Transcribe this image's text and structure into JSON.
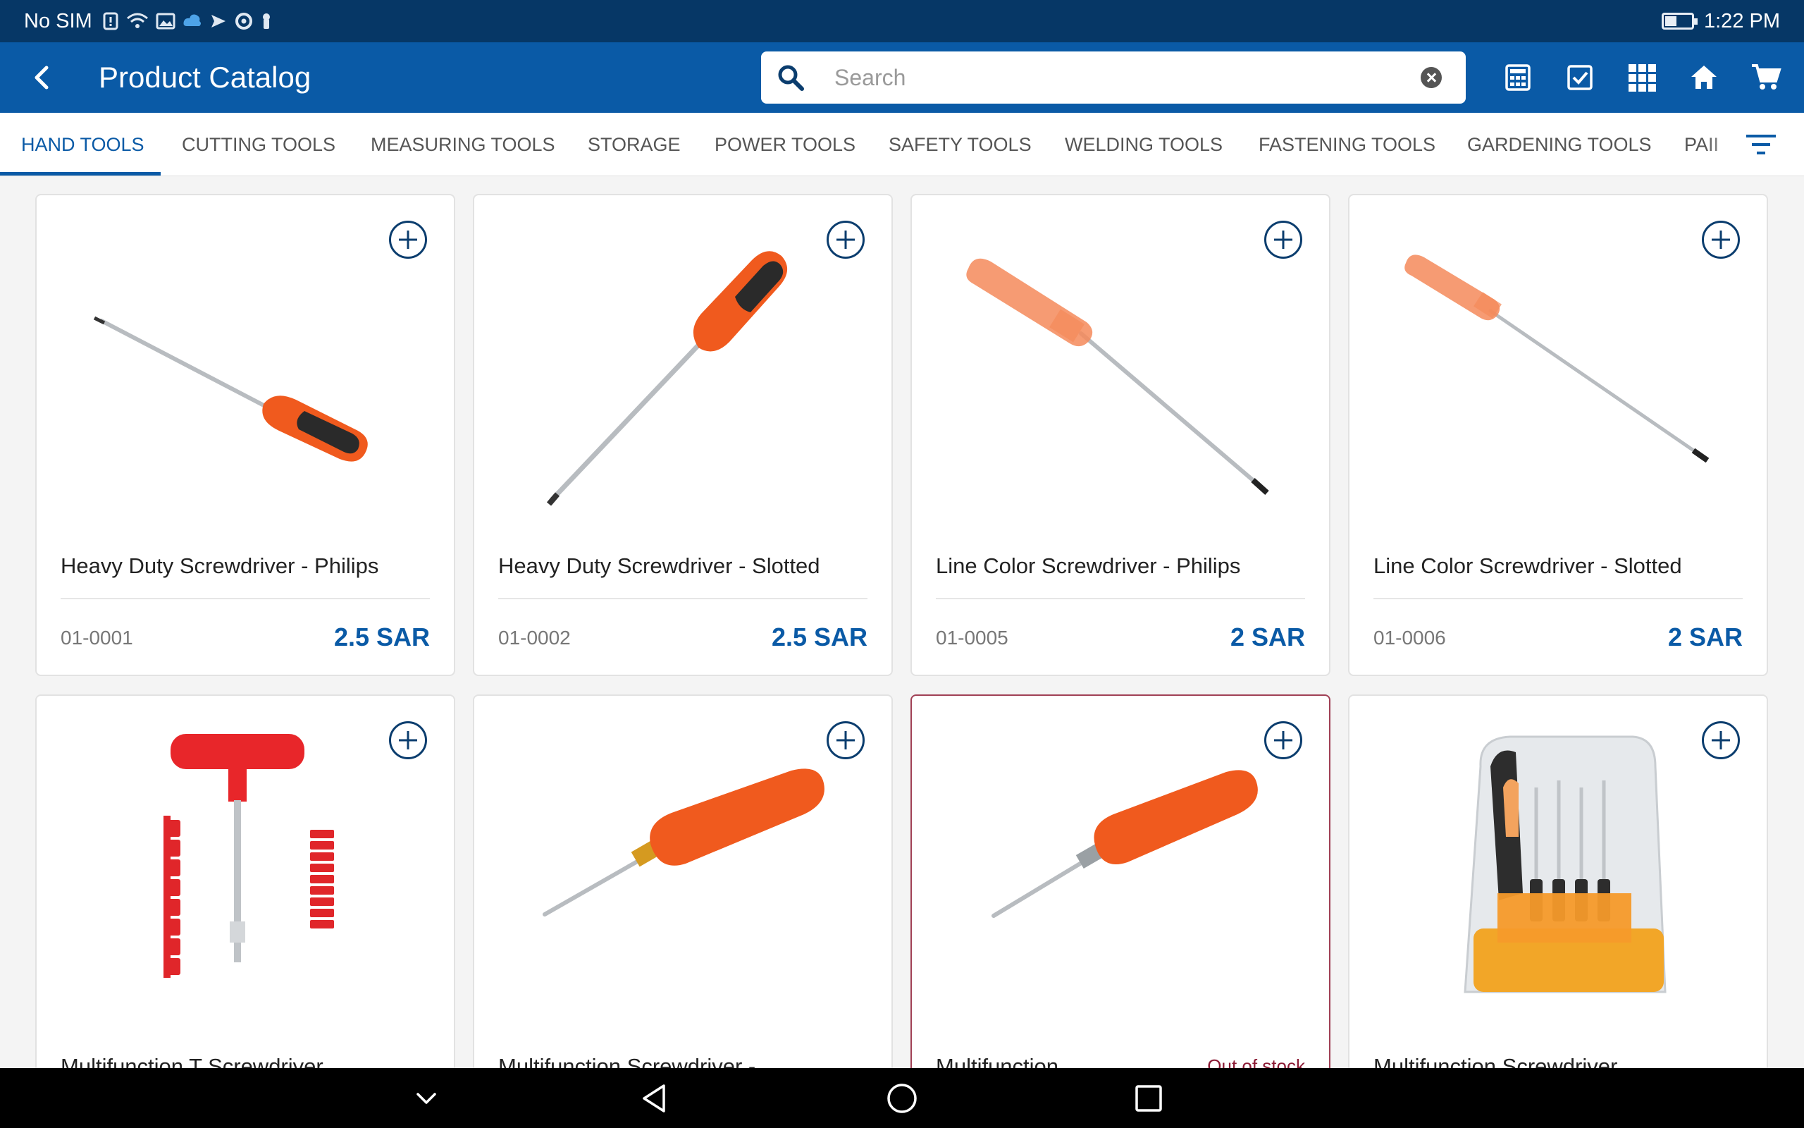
{
  "status_bar": {
    "carrier": "No SIM",
    "time": "1:22 PM"
  },
  "app_bar": {
    "title": "Product Catalog",
    "search_placeholder": "Search"
  },
  "tabs": [
    "HAND TOOLS",
    "CUTTING TOOLS",
    "MEASURING TOOLS",
    "STORAGE",
    "POWER TOOLS",
    "SAFETY TOOLS",
    "WELDING TOOLS",
    "FASTENING TOOLS",
    "GARDENING TOOLS",
    "PAII"
  ],
  "active_tab": "HAND TOOLS",
  "products": [
    {
      "name": "Heavy Duty Screwdriver - Philips",
      "sku": "01-0001",
      "price": "2.5 SAR"
    },
    {
      "name": "Heavy Duty Screwdriver - Slotted",
      "sku": "01-0002",
      "price": "2.5 SAR"
    },
    {
      "name": "Line Color Screwdriver - Philips",
      "sku": "01-0005",
      "price": "2 SAR"
    },
    {
      "name": "Line Color Screwdriver - Slotted",
      "sku": "01-0006",
      "price": "2 SAR"
    },
    {
      "name": "Multifunction T Screwdriver"
    },
    {
      "name": "Multifunction Screwdriver  -"
    },
    {
      "name": "Multifunction",
      "status": "Out of stock"
    },
    {
      "name": "Multifunction Screwdriver"
    }
  ],
  "colors": {
    "status_bar": "#063766",
    "app_bar": "#0a5aa6",
    "price": "#0a5aa6",
    "tool_orange": "#f05a1e",
    "out_of_stock": "#8b1a34"
  },
  "icons": [
    "back-arrow-icon",
    "search-icon",
    "clear-icon",
    "calculator-icon",
    "checklist-icon",
    "grid-icon",
    "home-icon",
    "cart-icon",
    "filter-icon",
    "add-icon",
    "nav-collapse-icon",
    "nav-back-icon",
    "nav-home-icon",
    "nav-recents-icon"
  ]
}
